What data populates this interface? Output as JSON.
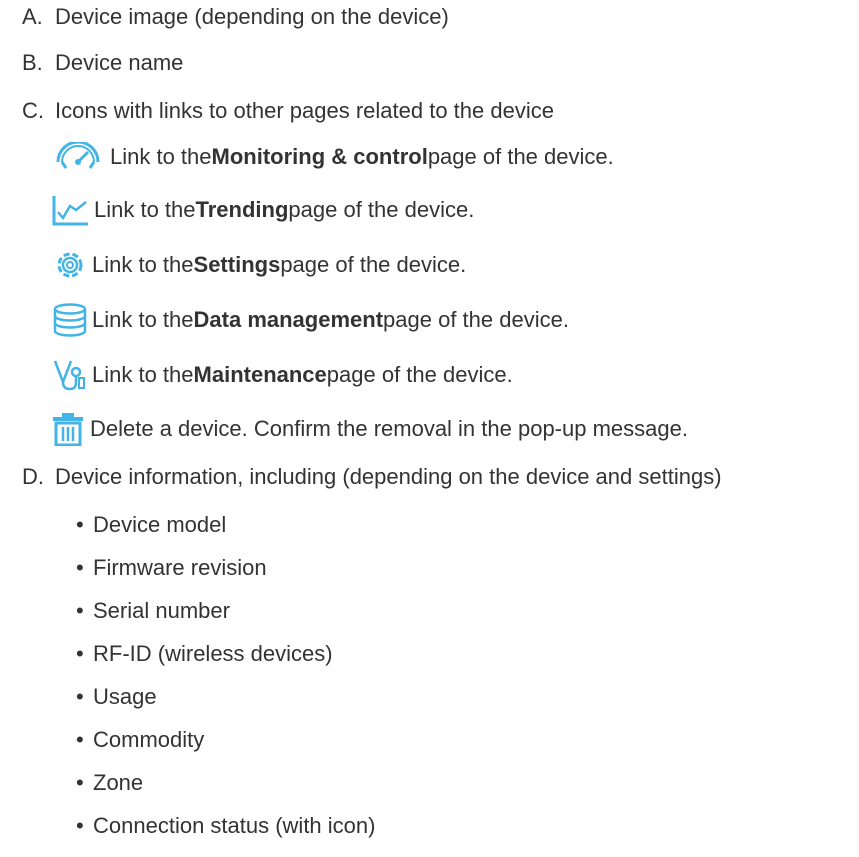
{
  "sections": [
    {
      "letter": "A.",
      "text": "Device image (depending on the device)"
    },
    {
      "letter": "B.",
      "text": "Device name"
    },
    {
      "letter": "C.",
      "text": "Icons with links to other pages related to the device"
    },
    {
      "letter": "D.",
      "text": "Device information, including (depending on the device and settings)"
    }
  ],
  "icon_links": [
    {
      "icon": "speedometer-icon",
      "prefix": "Link to the ",
      "bold": "Monitoring & control",
      "suffix": " page of the device."
    },
    {
      "icon": "trending-chart-icon",
      "prefix": "Link to the ",
      "bold": "Trending",
      "suffix": " page of the device."
    },
    {
      "icon": "gear-icon",
      "prefix": "Link to the ",
      "bold": "Settings",
      "suffix": " page of the device."
    },
    {
      "icon": "database-icon",
      "prefix": "Link to the ",
      "bold": "Data management",
      "suffix": " page of the device."
    },
    {
      "icon": "stethoscope-icon",
      "prefix": "Link to the ",
      "bold": "Maintenance",
      "suffix": " page of the device."
    },
    {
      "icon": "trash-icon",
      "text": "Delete a device. Confirm the removal in the pop-up message."
    }
  ],
  "device_info_items": [
    "Device model",
    "Firmware revision",
    "Serial number",
    "RF-ID (wireless devices)",
    "Usage",
    "Commodity",
    "Zone",
    "Connection status (with icon)"
  ],
  "bullet_char": "•",
  "colors": {
    "text": "#333333",
    "icon": "#3dcd58",
    "icon_blue": "#42b4e6"
  }
}
